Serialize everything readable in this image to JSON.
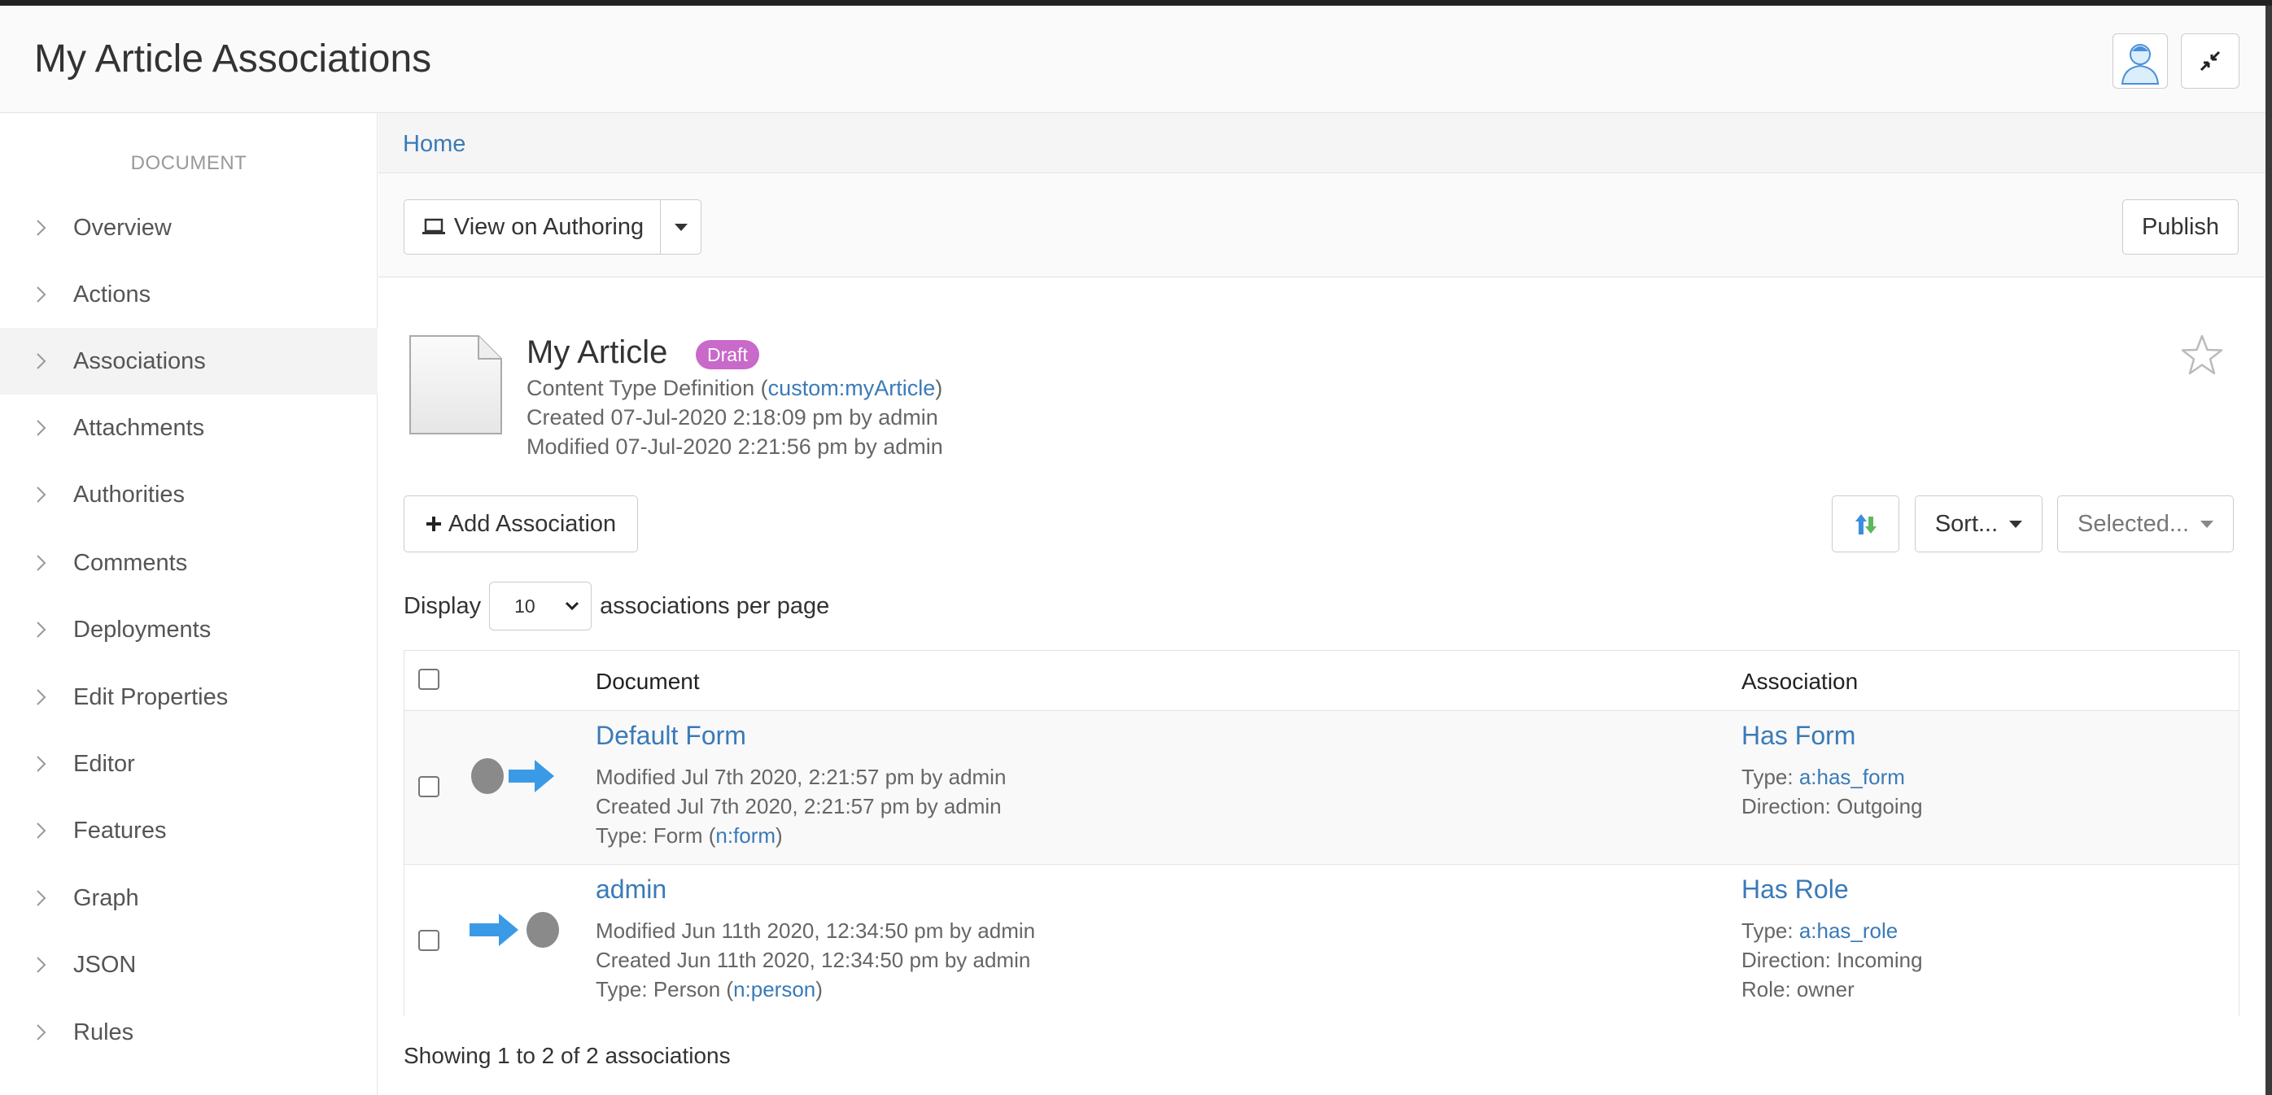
{
  "header": {
    "title": "My Article Associations"
  },
  "sidebar": {
    "heading": "DOCUMENT",
    "items": [
      {
        "label": "Overview"
      },
      {
        "label": "Actions"
      },
      {
        "label": "Associations"
      },
      {
        "label": "Attachments"
      },
      {
        "label": "Authorities"
      },
      {
        "label": "Comments"
      },
      {
        "label": "Deployments"
      },
      {
        "label": "Edit Properties"
      },
      {
        "label": "Editor"
      },
      {
        "label": "Features"
      },
      {
        "label": "Graph"
      },
      {
        "label": "JSON"
      },
      {
        "label": "Rules"
      }
    ]
  },
  "breadcrumb": {
    "home": "Home"
  },
  "toolbar": {
    "view_label": "View on Authoring",
    "publish_label": "Publish"
  },
  "document": {
    "title": "My Article",
    "badge": "Draft",
    "type_prefix": "Content Type Definition (",
    "type_link": "custom:myArticle",
    "type_suffix": ")",
    "created": "Created 07-Jul-2020 2:18:09 pm by admin",
    "modified": "Modified 07-Jul-2020 2:21:56 pm by admin"
  },
  "actions": {
    "add_label": "Add Association",
    "sort_label": "Sort...",
    "selected_label": "Selected..."
  },
  "display": {
    "prefix": "Display",
    "value": "10",
    "suffix": "associations per page"
  },
  "table": {
    "columns": {
      "document": "Document",
      "association": "Association"
    },
    "rows": [
      {
        "name": "Default Form",
        "modified": "Modified Jul 7th 2020, 2:21:57 pm by admin",
        "created": "Created Jul 7th 2020, 2:21:57 pm by admin",
        "type_prefix": "Type: Form (",
        "type_link": "n:form",
        "type_suffix": ")",
        "assoc_name": "Has Form",
        "assoc_type_prefix": "Type: ",
        "assoc_type": "a:has_form",
        "direction": "Direction: Outgoing"
      },
      {
        "name": "admin",
        "modified": "Modified Jun 11th 2020, 12:34:50 pm by admin",
        "created": "Created Jun 11th 2020, 12:34:50 pm by admin",
        "type_prefix": "Type: Person (",
        "type_link": "n:person",
        "type_suffix": ")",
        "assoc_name": "Has Role",
        "assoc_type_prefix": "Type: ",
        "assoc_type": "a:has_role",
        "direction": "Direction: Incoming",
        "role": "Role: owner"
      }
    ]
  },
  "footer": {
    "showing": "Showing 1 to 2 of 2 associations"
  },
  "colors": {
    "link": "#3a7ab8",
    "badge": "#c969c9",
    "arrow": "#3b9ae6"
  }
}
